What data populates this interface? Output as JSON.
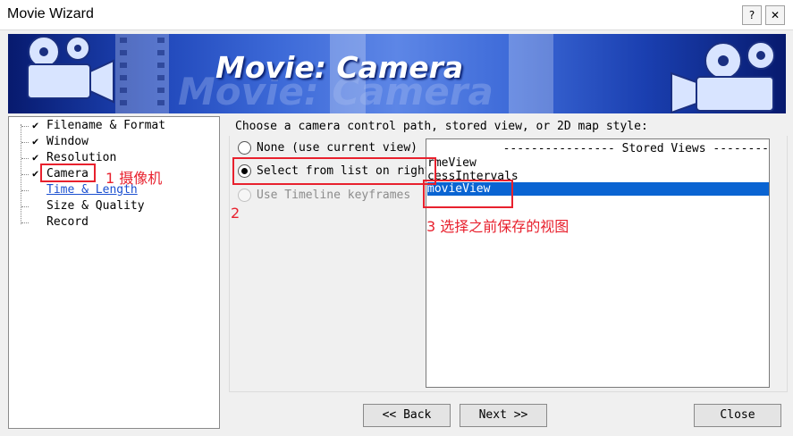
{
  "window": {
    "title": "Movie Wizard",
    "help_label": "?",
    "close_label": "✕"
  },
  "banner": {
    "title": "Movie: Camera"
  },
  "tree": {
    "items": [
      {
        "label": "Filename & Format",
        "checked": true
      },
      {
        "label": "Window",
        "checked": true
      },
      {
        "label": "Resolution",
        "checked": true
      },
      {
        "label": "Camera",
        "checked": true
      },
      {
        "label": "Time & Length",
        "checked": false
      },
      {
        "label": "Size & Quality",
        "checked": false
      },
      {
        "label": "Record",
        "checked": false
      }
    ],
    "check_glyph": "✔"
  },
  "camera": {
    "instruction": "Choose a camera control path, stored view, or 2D map style:",
    "options": [
      {
        "label": "None (use current view)",
        "selected": false,
        "enabled": true
      },
      {
        "label": "Select from list on right:",
        "selected": true,
        "enabled": true
      },
      {
        "label": "Use Timeline keyframes",
        "selected": false,
        "enabled": false
      }
    ],
    "list_header": "---------------- Stored Views --------",
    "list_items": [
      "rmeView",
      "cessIntervals",
      "movieView"
    ],
    "selected_item": "movieView"
  },
  "buttons": {
    "back": "<< Back",
    "next": "Next >>",
    "close": "Close"
  },
  "annotations": {
    "step1": "1 摄像机",
    "step2": "2",
    "step3": "3 选择之前保存的视图",
    "color": "#e8212e"
  }
}
